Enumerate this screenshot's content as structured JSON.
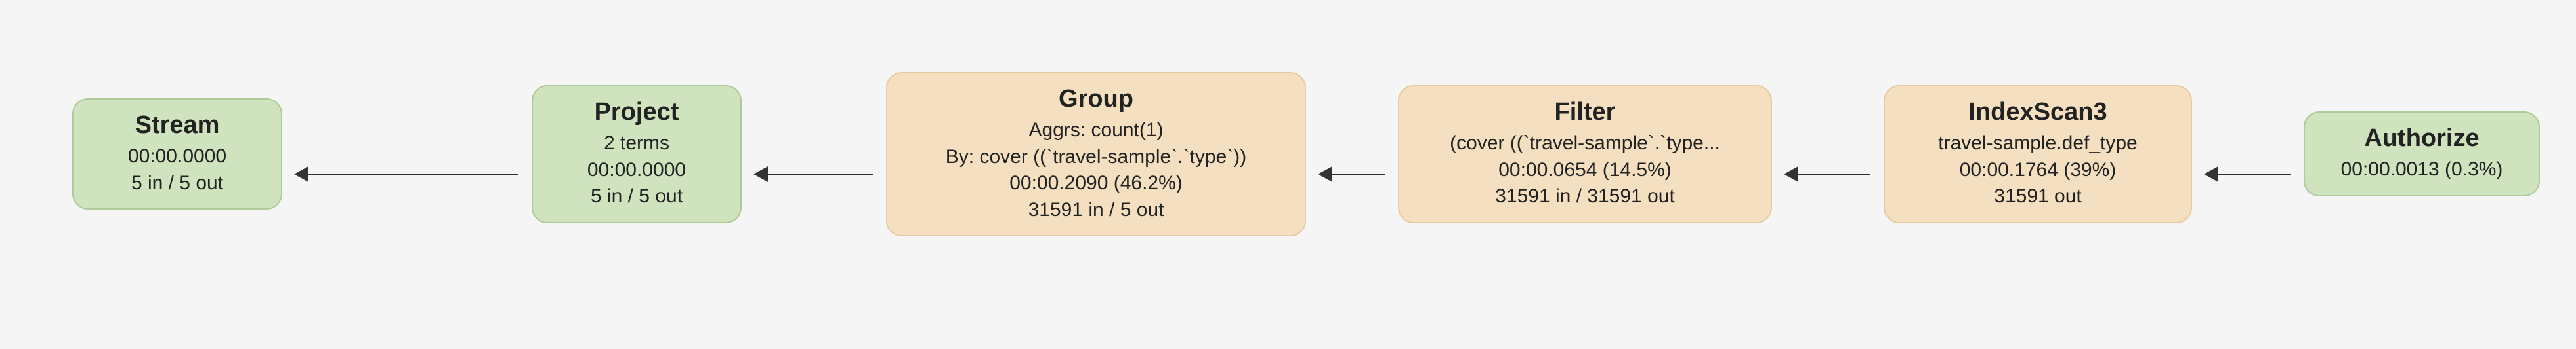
{
  "nodes": {
    "stream": {
      "title": "Stream",
      "time": "00:00.0000",
      "io": "5 in / 5 out"
    },
    "project": {
      "title": "Project",
      "terms": "2 terms",
      "time": "00:00.0000",
      "io": "5 in / 5 out"
    },
    "group": {
      "title": "Group",
      "aggrs": "Aggrs: count(1)",
      "by": "By: cover ((`travel-sample`.`type`))",
      "time": "00:00.2090 (46.2%)",
      "io": "31591 in / 5 out"
    },
    "filter": {
      "title": "Filter",
      "expr": "(cover ((`travel-sample`.`type...",
      "time": "00:00.0654 (14.5%)",
      "io": "31591 in / 31591 out"
    },
    "indexscan": {
      "title": "IndexScan3",
      "idx": "travel-sample.def_type",
      "time": "00:00.1764 (39%)",
      "io": "31591 out"
    },
    "authorize": {
      "title": "Authorize",
      "time": "00:00.0013 (0.3%)"
    }
  }
}
